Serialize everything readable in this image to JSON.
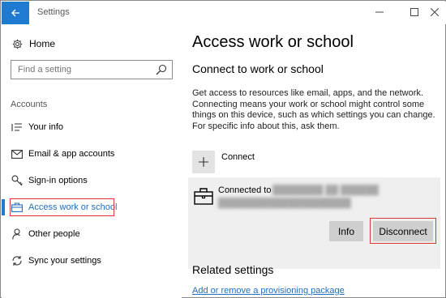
{
  "window": {
    "title": "Settings",
    "controls": {
      "minimize": "—",
      "maximize": "☐",
      "close": "✕"
    }
  },
  "sidebar": {
    "home_label": "Home",
    "search_placeholder": "Find a setting",
    "section_label": "Accounts",
    "items": [
      {
        "label": "Your info",
        "icon": "your-info-icon"
      },
      {
        "label": "Email & app accounts",
        "icon": "email-icon"
      },
      {
        "label": "Sign-in options",
        "icon": "key-icon"
      },
      {
        "label": "Access work or school",
        "icon": "briefcase-icon",
        "active": true
      },
      {
        "label": "Other people",
        "icon": "person-icon"
      },
      {
        "label": "Sync your settings",
        "icon": "sync-icon"
      }
    ]
  },
  "main": {
    "page_title": "Access work or school",
    "subheading": "Connect to work or school",
    "description": "Get access to resources like email, apps, and the network. Connecting means your work or school might control some things on this device, such as which settings you can change. For specific info about this, ask them.",
    "connect_label": "Connect",
    "account": {
      "connected_to_label": "Connected to",
      "info_button": "Info",
      "disconnect_button": "Disconnect"
    },
    "related_heading": "Related settings",
    "related_link": "Add or remove a provisioning package"
  },
  "colors": {
    "accent": "#1f7ad1",
    "highlight": "#d83a3a",
    "link": "#1f6fbf"
  }
}
